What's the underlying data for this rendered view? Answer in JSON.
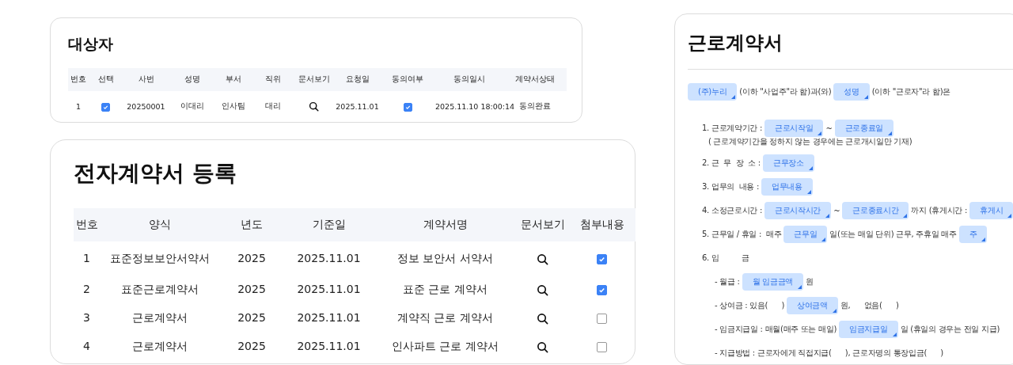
{
  "targets": {
    "title": "대상자",
    "columns": [
      "번호",
      "선택",
      "사번",
      "성명",
      "부서",
      "직위",
      "문서보기",
      "요청일",
      "동의여부",
      "동의일시",
      "계약서상태"
    ],
    "rows": [
      {
        "no": "1",
        "selected": true,
        "employee_id": "20250001",
        "name": "이대리",
        "department": "인사팀",
        "position": "대리",
        "requested": "2025.11.01",
        "agreed": true,
        "agreed_at": "2025.11.10  18:00:14",
        "status": "동의완료"
      }
    ]
  },
  "registration": {
    "title": "전자계약서 등록",
    "columns": [
      "번호",
      "양식",
      "년도",
      "기준일",
      "계약서명",
      "문서보기",
      "첨부내용"
    ],
    "rows": [
      {
        "no": "1",
        "form": "표준정보보안서약서",
        "year": "2025",
        "base_date": "2025.11.01",
        "contract_name": "정보 보안서 서약서",
        "attached": true
      },
      {
        "no": "2",
        "form": "표준근로계약서",
        "year": "2025",
        "base_date": "2025.11.01",
        "contract_name": "표준 근로 계약서",
        "attached": true
      },
      {
        "no": "3",
        "form": "근로계약서",
        "year": "2025",
        "base_date": "2025.11.01",
        "contract_name": "계약직 근로 계약서",
        "attached": false
      },
      {
        "no": "4",
        "form": "근로계약서",
        "year": "2025",
        "base_date": "2025.11.01",
        "contract_name": "인사파트 근로 계약서",
        "attached": false
      }
    ]
  },
  "contract": {
    "title": "근로계약서",
    "lines": [
      {
        "kind": "intro",
        "parts": [
          {
            "kind": "field",
            "text": "(주)누리"
          },
          {
            "kind": "text",
            "text": "(이하 \"사업주\"라 함)과(와)"
          },
          {
            "kind": "field",
            "text": "성명"
          },
          {
            "kind": "text",
            "text": "(이하 \"근로자\"라 함)은"
          }
        ]
      },
      {
        "kind": "item",
        "parts": [
          {
            "kind": "text",
            "text": "1. 근로계약기간 :"
          },
          {
            "kind": "field",
            "text": "근로시작일"
          },
          {
            "kind": "text",
            "text": "~"
          },
          {
            "kind": "field",
            "text": "근로종료일"
          }
        ]
      },
      {
        "kind": "note",
        "parts": [
          {
            "kind": "text",
            "text": "( 근로계약기간을 정하지 않는 경우에는 근로개시일만 기재)"
          }
        ]
      },
      {
        "kind": "item",
        "parts": [
          {
            "kind": "text",
            "text": "2. 근  무  장  소 :"
          },
          {
            "kind": "field",
            "text": "근무장소"
          }
        ]
      },
      {
        "kind": "item",
        "parts": [
          {
            "kind": "text",
            "text": "3. 업무의  내용 :"
          },
          {
            "kind": "field",
            "text": "업무내용"
          }
        ]
      },
      {
        "kind": "item",
        "parts": [
          {
            "kind": "text",
            "text": "4. 소정근로시간 :"
          },
          {
            "kind": "field",
            "text": "근로시작시간"
          },
          {
            "kind": "text",
            "text": "~"
          },
          {
            "kind": "field",
            "text": "근로종료시간"
          },
          {
            "kind": "text",
            "text": "까지 (휴게시간 :"
          },
          {
            "kind": "field",
            "text": "휴게시"
          }
        ]
      },
      {
        "kind": "item",
        "parts": [
          {
            "kind": "text",
            "text": "5. 근무일 / 휴일 :  매주"
          },
          {
            "kind": "field",
            "text": "근무일"
          },
          {
            "kind": "text",
            "text": "일(또는 매일 단위) 근무, 주휴일 매주"
          },
          {
            "kind": "field",
            "text": "주"
          }
        ]
      },
      {
        "kind": "item",
        "parts": [
          {
            "kind": "text",
            "text": "6. 임          금"
          }
        ]
      },
      {
        "kind": "sub",
        "parts": [
          {
            "kind": "text",
            "text": "- 월급 :"
          },
          {
            "kind": "field",
            "text": "월 임금금액"
          },
          {
            "kind": "text",
            "text": "원"
          }
        ]
      },
      {
        "kind": "sub",
        "parts": [
          {
            "kind": "text",
            "text": "- 상여금 : 있음(      )"
          },
          {
            "kind": "field",
            "text": "상여금액"
          },
          {
            "kind": "text",
            "text": "원,      없음(      )"
          }
        ]
      },
      {
        "kind": "sub",
        "parts": [
          {
            "kind": "text",
            "text": "- 임금지급일 : 매월(매주 또는 매일)"
          },
          {
            "kind": "field",
            "text": "임금지급일"
          },
          {
            "kind": "text",
            "text": "일 (휴일의 경우는 전일 지급)"
          }
        ]
      },
      {
        "kind": "sub",
        "parts": [
          {
            "kind": "text",
            "text": "- 지급방법 : 근로자에게 직접지급(      ), 근로자명의 통장입금(      )"
          }
        ]
      }
    ]
  }
}
